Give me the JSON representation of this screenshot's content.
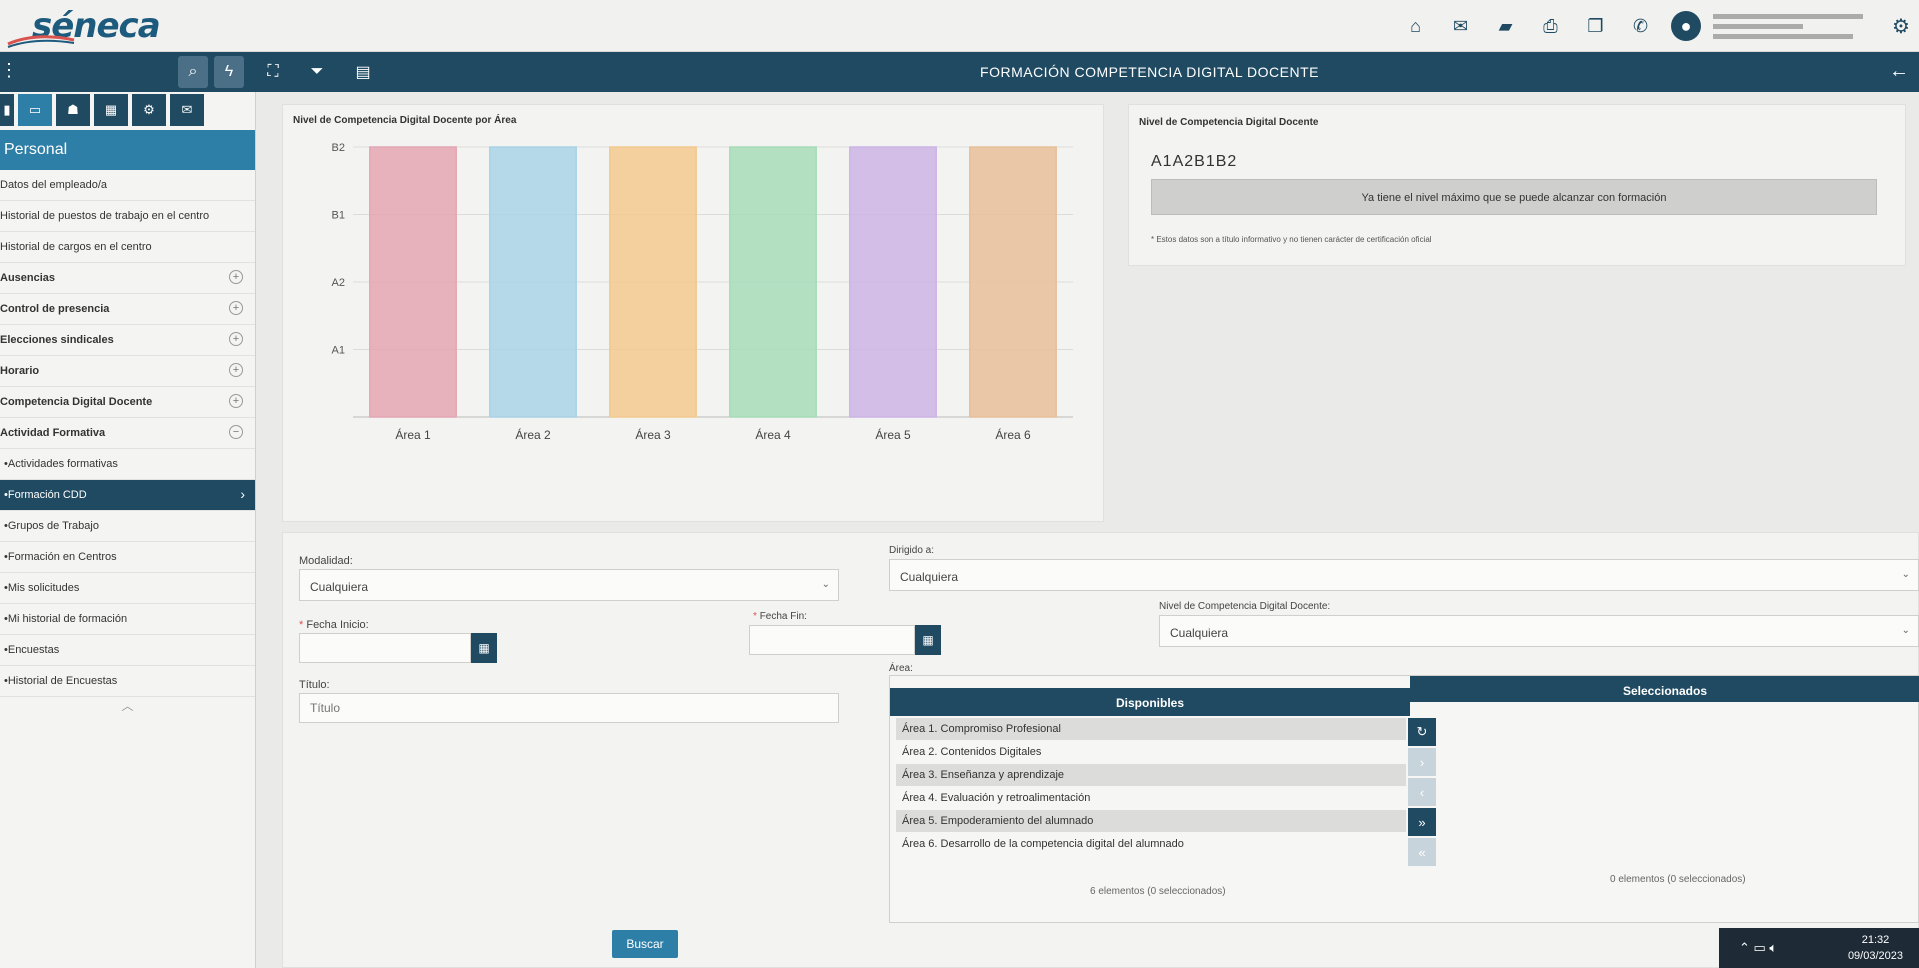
{
  "app": {
    "logo": "séneca",
    "page_title": "FORMACIÓN COMPETENCIA DIGITAL DOCENTE"
  },
  "topbar_icons": [
    "home-icon",
    "mail-icon",
    "folder-icon",
    "print-icon",
    "copy-icon",
    "phone-icon"
  ],
  "sidebar": {
    "header": "Personal",
    "items": [
      {
        "label": "Datos del empleado/a",
        "bold": false,
        "expand": ""
      },
      {
        "label": "Historial de puestos de trabajo en el centro",
        "bold": false,
        "expand": ""
      },
      {
        "label": "Historial de cargos en el centro",
        "bold": false,
        "expand": ""
      },
      {
        "label": "Ausencias",
        "bold": true,
        "expand": "+"
      },
      {
        "label": "Control de presencia",
        "bold": true,
        "expand": "+"
      },
      {
        "label": "Elecciones sindicales",
        "bold": true,
        "expand": "+"
      },
      {
        "label": "Horario",
        "bold": true,
        "expand": "+"
      },
      {
        "label": "Competencia Digital Docente",
        "bold": true,
        "expand": "+"
      },
      {
        "label": "Actividad Formativa",
        "bold": true,
        "expand": "−"
      },
      {
        "label": "•Actividades formativas",
        "bold": false,
        "expand": ""
      },
      {
        "label": "•Formación CDD",
        "bold": false,
        "expand": "",
        "active": true
      },
      {
        "label": "•Grupos de Trabajo",
        "bold": false,
        "expand": ""
      },
      {
        "label": "•Formación en Centros",
        "bold": false,
        "expand": ""
      },
      {
        "label": "•Mis solicitudes",
        "bold": false,
        "expand": ""
      },
      {
        "label": "•Mi historial de formación",
        "bold": false,
        "expand": ""
      },
      {
        "label": "•Encuestas",
        "bold": false,
        "expand": ""
      },
      {
        "label": "•Historial de Encuestas",
        "bold": false,
        "expand": ""
      }
    ]
  },
  "chart_card": {
    "title": "Nivel de Competencia Digital Docente por Área"
  },
  "chart_data": {
    "type": "bar",
    "categories": [
      "Área 1",
      "Área 2",
      "Área 3",
      "Área 4",
      "Área 5",
      "Área 6"
    ],
    "y_categories": [
      "A1",
      "A2",
      "B1",
      "B2"
    ],
    "values": [
      "B2",
      "B2",
      "B2",
      "B2",
      "B2",
      "B2"
    ],
    "colors": [
      "#e4a6b3",
      "#a9d3e6",
      "#f2c98f",
      "#a6dcb8",
      "#cdb4e6",
      "#e8bf9a"
    ],
    "grid": true,
    "legend": "none"
  },
  "level_card": {
    "title": "Nivel de Competencia Digital Docente",
    "code": "A1A2B1B2",
    "banner": "Ya tiene el nivel máximo que se puede alcanzar con formación",
    "note": "* Estos datos son a título informativo y no tienen carácter de certificación oficial"
  },
  "form": {
    "modalidad_label": "Modalidad:",
    "modalidad_value": "Cualquiera",
    "dirigido_label": "Dirigido a:",
    "dirigido_value": "Cualquiera",
    "fecha_inicio_label": "Fecha Inicio:",
    "fecha_fin_label": "Fecha Fin:",
    "nivel_label": "Nivel de Competencia Digital Docente:",
    "nivel_value": "Cualquiera",
    "titulo_label": "Título:",
    "titulo_placeholder": "Título",
    "area_label": "Área:",
    "disponibles_header": "Disponibles",
    "seleccionados_header": "Seleccionados",
    "areas": [
      "Área 1. Compromiso Profesional",
      "Área 2. Contenidos Digitales",
      "Área 3. Enseñanza y aprendizaje",
      "Área 4. Evaluación y retroalimentación",
      "Área 5. Empoderamiento del alumnado",
      "Área 6. Desarrollo de la competencia digital del alumnado"
    ],
    "disponibles_count": "6 elementos (0 seleccionados)",
    "seleccionados_count": "0 elementos (0 seleccionados)",
    "buscar": "Buscar"
  },
  "taskbar": {
    "time": "21:32",
    "date": "09/03/2023"
  }
}
